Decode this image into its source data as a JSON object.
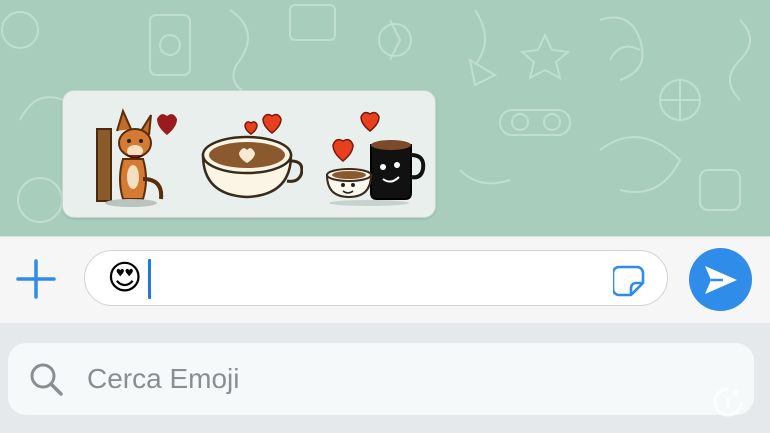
{
  "chat": {
    "stickers": [
      {
        "name": "fox-with-heart-sticker"
      },
      {
        "name": "cappuccino-heart-sticker"
      },
      {
        "name": "coffee-mugs-love-sticker"
      }
    ]
  },
  "composer": {
    "input_value": "😍",
    "icons": [
      "plus-icon",
      "sticker-icon",
      "send-icon"
    ]
  },
  "emoji_search": {
    "placeholder": "Cerca Emoji",
    "icon": "search-icon"
  },
  "colors": {
    "chat_background": "#a8cdbd",
    "accent": "#2f8ce8",
    "caret": "#1f7bd6"
  }
}
